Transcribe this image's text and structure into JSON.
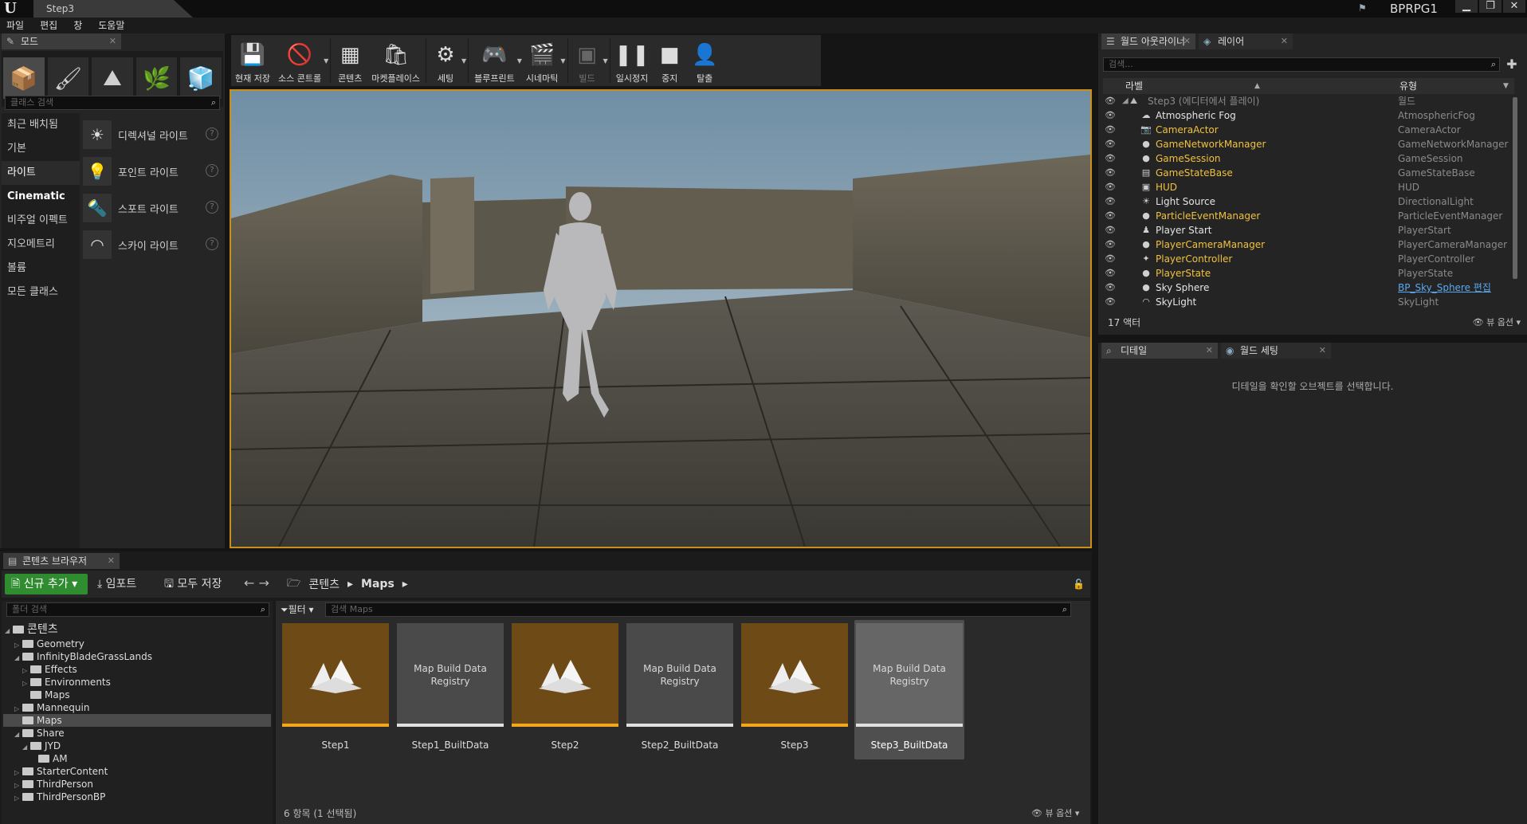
{
  "window": {
    "tab_title": "Step3",
    "project": "BPRPG1",
    "controls": [
      "▁",
      "❐",
      "✕"
    ]
  },
  "menu": [
    "파일",
    "편집",
    "창",
    "도움말"
  ],
  "modes": {
    "tab": "모드",
    "search_placeholder": "클래스 검색",
    "categories": [
      "최근 배치됨",
      "기본",
      "라이트",
      "Cinematic",
      "비주얼 이펙트",
      "지오메트리",
      "볼륨",
      "모든 클래스"
    ],
    "lights": [
      "디렉셔널 라이트",
      "포인트 라이트",
      "스포트 라이트",
      "스카이 라이트"
    ]
  },
  "toolbar": [
    "현재 저장",
    "소스 콘트롤",
    "콘텐츠",
    "마켓플레이스",
    "세팅",
    "블루프린트",
    "시네마틱",
    "빌드",
    "일시정지",
    "중지",
    "탈출"
  ],
  "outliner": {
    "tabs": [
      "월드 아웃라이너",
      "레이어"
    ],
    "search_placeholder": "검색...",
    "col_label": "라벨",
    "col_type": "유형",
    "root": "Step3 (에디터에서 플레이)",
    "root_type": "월드",
    "rows": [
      {
        "name": "Atmospheric Fog",
        "type": "AtmosphericFog"
      },
      {
        "name": "CameraActor",
        "type": "CameraActor"
      },
      {
        "name": "GameNetworkManager",
        "type": "GameNetworkManager"
      },
      {
        "name": "GameSession",
        "type": "GameSession"
      },
      {
        "name": "GameStateBase",
        "type": "GameStateBase"
      },
      {
        "name": "HUD",
        "type": "HUD"
      },
      {
        "name": "Light Source",
        "type": "DirectionalLight"
      },
      {
        "name": "ParticleEventManager",
        "type": "ParticleEventManager"
      },
      {
        "name": "Player Start",
        "type": "PlayerStart"
      },
      {
        "name": "PlayerCameraManager",
        "type": "PlayerCameraManager"
      },
      {
        "name": "PlayerController",
        "type": "PlayerController"
      },
      {
        "name": "PlayerState",
        "type": "PlayerState"
      },
      {
        "name": "Sky Sphere",
        "type": "BP_Sky_Sphere 편집"
      },
      {
        "name": "SkyLight",
        "type": "SkyLight"
      }
    ],
    "count": "17 액터",
    "view_options": "뷰 옵션"
  },
  "details": {
    "tabs": [
      "디테일",
      "월드 세팅"
    ],
    "message": "디테일을 확인할 오브젝트를 선택합니다."
  },
  "content_browser": {
    "tab": "콘텐츠 브라우저",
    "add_new": "신규 추가",
    "import": "임포트",
    "save_all": "모두 저장",
    "path": [
      "콘텐츠",
      "Maps"
    ],
    "folder_search_placeholder": "폴더 검색",
    "filter": "필터",
    "asset_search_placeholder": "검색 Maps",
    "tree": [
      {
        "label": "콘텐츠",
        "depth": 0
      },
      {
        "label": "Geometry",
        "depth": 1
      },
      {
        "label": "InfinityBladeGrassLands",
        "depth": 1
      },
      {
        "label": "Effects",
        "depth": 2
      },
      {
        "label": "Environments",
        "depth": 2
      },
      {
        "label": "Maps",
        "depth": 2
      },
      {
        "label": "Mannequin",
        "depth": 1
      },
      {
        "label": "Maps",
        "depth": 1
      },
      {
        "label": "Share",
        "depth": 1
      },
      {
        "label": "JYD",
        "depth": 2
      },
      {
        "label": "AM",
        "depth": 3
      },
      {
        "label": "StarterContent",
        "depth": 1
      },
      {
        "label": "ThirdPerson",
        "depth": 1
      },
      {
        "label": "ThirdPersonBP",
        "depth": 1
      }
    ],
    "assets": [
      {
        "label": "Step1",
        "kind": "map"
      },
      {
        "label": "Step1_BuiltData",
        "kind": "registry",
        "thumb_text": "Map Build Data Registry"
      },
      {
        "label": "Step2",
        "kind": "map"
      },
      {
        "label": "Step2_BuiltData",
        "kind": "registry",
        "thumb_text": "Map Build Data Registry"
      },
      {
        "label": "Step3",
        "kind": "map"
      },
      {
        "label": "Step3_BuiltData",
        "kind": "registry",
        "thumb_text": "Map Build Data Registry"
      }
    ],
    "status": "6 항목 (1 선택됨)",
    "view_options": "뷰 옵션"
  }
}
